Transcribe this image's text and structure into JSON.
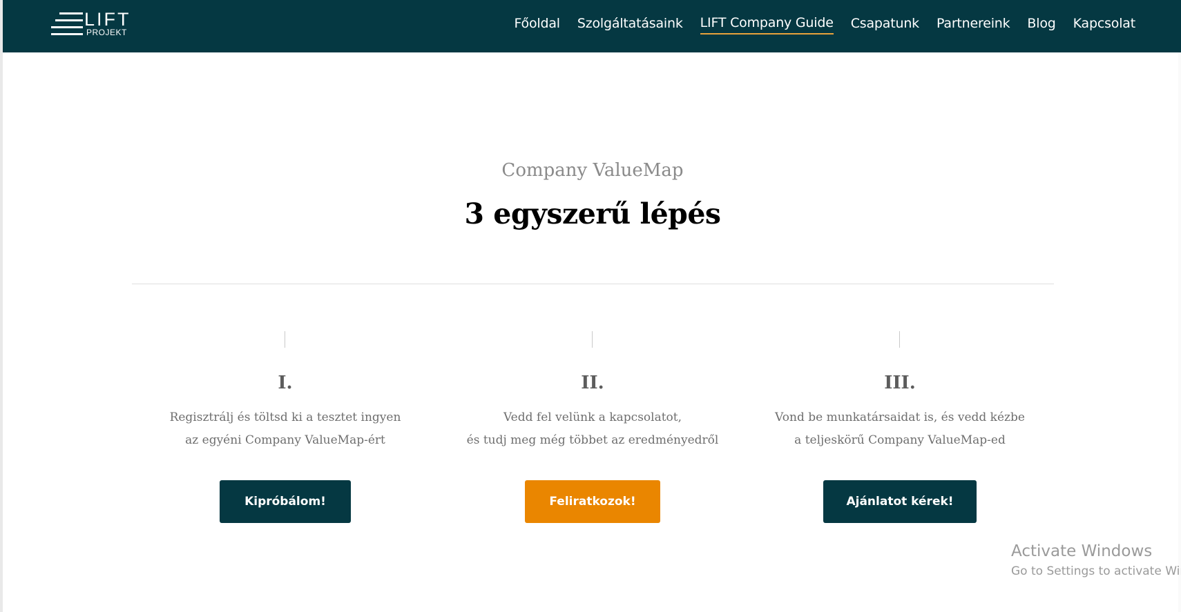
{
  "header": {
    "logo": {
      "big": "LIFT",
      "small": "PROJEKT"
    },
    "nav": [
      {
        "label": "Főoldal"
      },
      {
        "label": "Szolgáltatásaink"
      },
      {
        "label": "LIFT Company Guide"
      },
      {
        "label": "Csapatunk"
      },
      {
        "label": "Partnereink"
      },
      {
        "label": "Blog"
      },
      {
        "label": "Kapcsolat"
      }
    ],
    "active_index": 2,
    "accent_color": "#e9a23b",
    "background_color": "#053842"
  },
  "section": {
    "subtitle": "Company ValueMap",
    "title": "3 egyszerű lépés"
  },
  "steps": [
    {
      "numeral": "I.",
      "line1": "Regisztrálj és töltsd ki a tesztet ingyen",
      "line2": "az egyéni Company ValueMap-ért",
      "button": "Kipróbálom!",
      "button_color": "#053842"
    },
    {
      "numeral": "II.",
      "line1": "Vedd fel velünk a kapcsolatot,",
      "line2": "és tudj meg még többet az eredményedről",
      "button": "Feliratkozok!",
      "button_color": "#ea8600"
    },
    {
      "numeral": "III.",
      "line1": "Vond be munkatársaidat is, és vedd kézbe",
      "line2": "a teljeskörű Company ValueMap-ed",
      "button": "Ajánlatot kérek!",
      "button_color": "#053842"
    }
  ],
  "watermark": {
    "title": "Activate Windows",
    "subtitle": "Go to Settings to activate Windows."
  }
}
